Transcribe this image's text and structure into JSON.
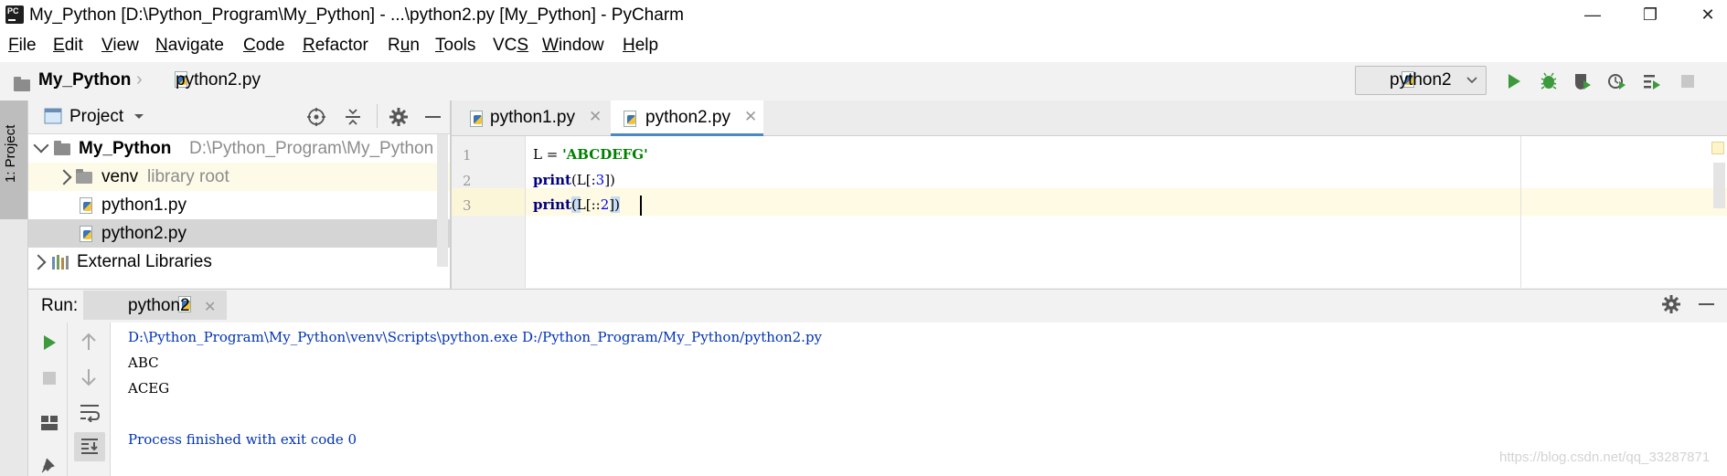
{
  "window": {
    "title": "My_Python [D:\\Python_Program\\My_Python] - ...\\python2.py [My_Python] - PyCharm",
    "app_icon_text": "PC",
    "minimize": "—",
    "restore": "❐",
    "close": "✕"
  },
  "menu": [
    {
      "pre": "",
      "u": "F",
      "post": "ile"
    },
    {
      "pre": "",
      "u": "E",
      "post": "dit"
    },
    {
      "pre": "",
      "u": "V",
      "post": "iew"
    },
    {
      "pre": "",
      "u": "N",
      "post": "avigate"
    },
    {
      "pre": "",
      "u": "C",
      "post": "ode"
    },
    {
      "pre": "",
      "u": "R",
      "post": "efactor"
    },
    {
      "pre": "R",
      "u": "u",
      "post": "n"
    },
    {
      "pre": "",
      "u": "T",
      "post": "ools"
    },
    {
      "pre": "VC",
      "u": "S",
      "post": ""
    },
    {
      "pre": "",
      "u": "W",
      "post": "indow"
    },
    {
      "pre": "",
      "u": "H",
      "post": "elp"
    }
  ],
  "breadcrumb": {
    "project": "My_Python",
    "separator": "›",
    "file": "python2.py"
  },
  "run_config": {
    "name": "python2"
  },
  "left_stripe": {
    "label": "1: Project"
  },
  "project_panel": {
    "title": "Project",
    "tree": [
      {
        "name": "My_Python",
        "hint": "D:\\Python_Program\\My_Python"
      },
      {
        "name": "venv",
        "hint": "library root"
      },
      {
        "name": "python1.py",
        "hint": ""
      },
      {
        "name": "python2.py",
        "hint": ""
      },
      {
        "name": "External Libraries",
        "hint": ""
      }
    ]
  },
  "editor": {
    "tabs": [
      {
        "label": "python1.py",
        "close": "✕"
      },
      {
        "label": "python2.py",
        "close": "✕"
      }
    ],
    "line_numbers": [
      "1",
      "2",
      "3"
    ],
    "lines": [
      {
        "a": "L = ",
        "b": "'ABCDEFG'",
        "c": ""
      },
      {
        "a": "print",
        "b": "(L[:",
        "n": "3",
        "c": "])"
      },
      {
        "a": "print",
        "b": "(L[::",
        "n": "2",
        "c": "])"
      }
    ]
  },
  "run_panel": {
    "label": "Run:",
    "tab": "python2",
    "tab_close": "✕",
    "output": [
      "D:\\Python_Program\\My_Python\\venv\\Scripts\\python.exe D:/Python_Program/My_Python/python2.py",
      "ABC",
      "ACEG",
      "",
      "Process finished with exit code 0"
    ]
  },
  "watermark": "https://blog.csdn.net/qq_33287871",
  "colors": {
    "keyword": "#000080",
    "string": "#008000",
    "number": "#0000ff",
    "run_green": "#3c9a3c",
    "console_blue": "#0033b3"
  }
}
